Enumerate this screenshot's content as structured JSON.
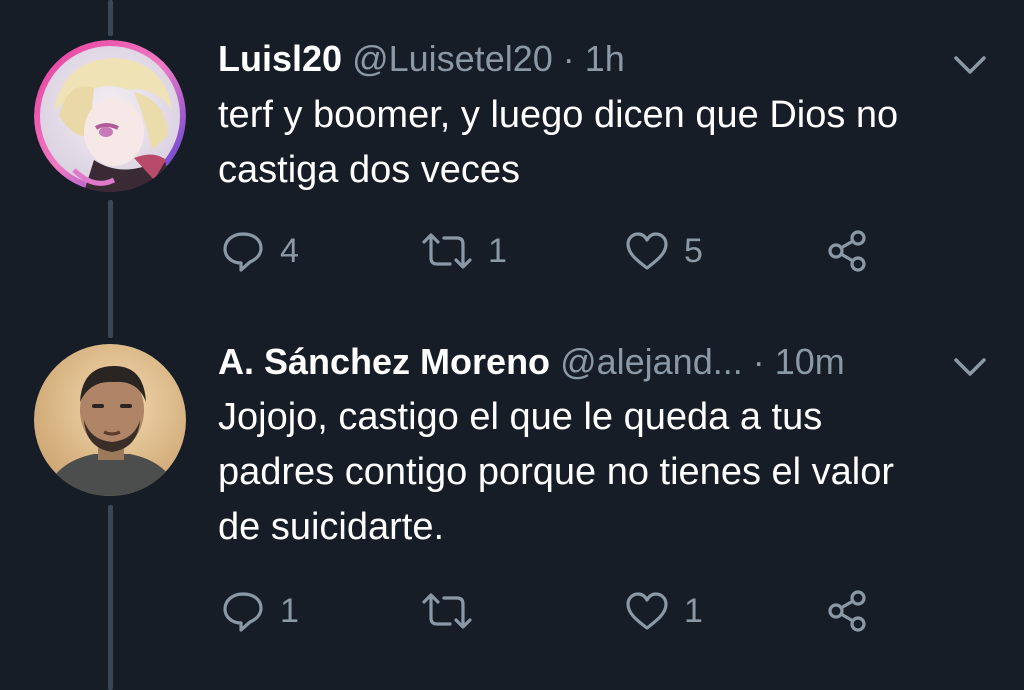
{
  "tweets": [
    {
      "display_name": "Luisl20",
      "handle": "@Luisetel20",
      "separator": "·",
      "time": "1h",
      "text_lines": [
        "terf y boomer, y luego dicen que Dios no",
        "castiga dos veces"
      ],
      "reply_count": "4",
      "retweet_count": "1",
      "like_count": "5",
      "avatar_icon": "anime-character-avatar"
    },
    {
      "display_name": "A. Sánchez Moreno",
      "handle": "@alejand...",
      "separator": "·",
      "time": "10m",
      "text_lines": [
        "Jojojo, castigo el que le queda a tus",
        "padres contigo porque no tienes el valor",
        "de suicidarte."
      ],
      "reply_count": "1",
      "retweet_count": "",
      "like_count": "1",
      "avatar_icon": "man-photo-avatar"
    }
  ],
  "colors": {
    "background": "#161d27",
    "text_primary": "#ffffff",
    "text_secondary": "#8b98a5",
    "thread_line": "#3c4756"
  }
}
